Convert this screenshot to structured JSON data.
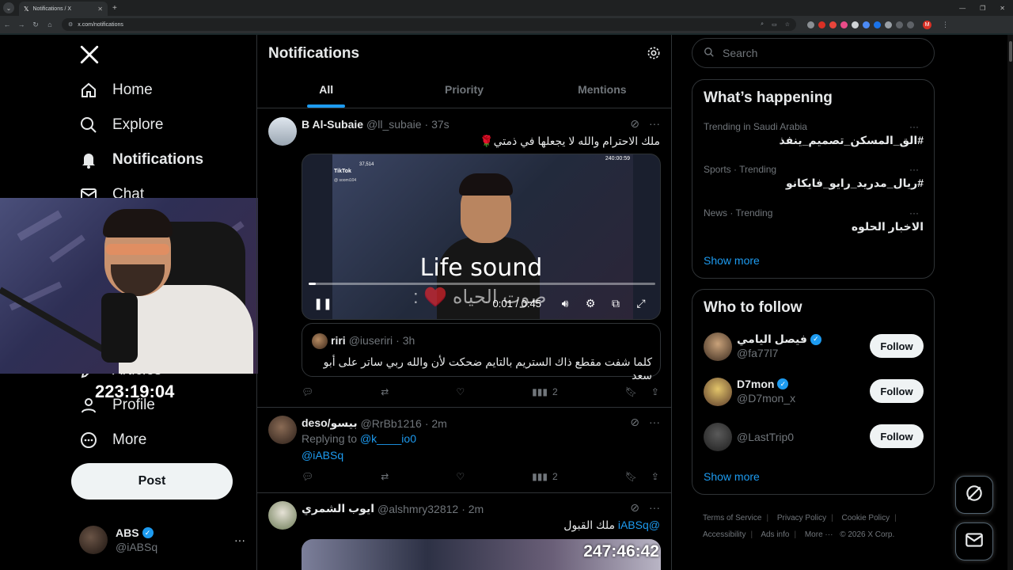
{
  "browser": {
    "tab_title": "Notifications / X",
    "url": "x.com/notifications",
    "profile_initial": "M"
  },
  "nav": {
    "items": [
      {
        "label": "Home",
        "icon": "home-icon"
      },
      {
        "label": "Explore",
        "icon": "search-icon"
      },
      {
        "label": "Notifications",
        "icon": "bell-icon",
        "active": true
      },
      {
        "label": "Chat",
        "icon": "mail-icon"
      },
      {
        "label": "Articles",
        "icon": "article-icon"
      },
      {
        "label": "Profile",
        "icon": "user-icon"
      },
      {
        "label": "More",
        "icon": "more-circle-icon"
      }
    ],
    "post_button": "Post",
    "account": {
      "name": "ABS",
      "handle": "@iABSq"
    }
  },
  "overlay": {
    "timer": "223:19:04"
  },
  "main": {
    "title": "Notifications",
    "tabs": [
      "All",
      "Priority",
      "Mentions"
    ],
    "posts": [
      {
        "name": "B Al-Subaie",
        "handle": "@ll_subaie",
        "time": "· 37s",
        "text": "ملك الاحترام والله لا يجعلها في ذمتي🌹",
        "video": {
          "tiktok_label": "TikTok",
          "tiktok_handle": "@ soomi104",
          "tiktok_count": "37,514",
          "stamp": "240:00:59",
          "caption_en": "Life sound",
          "caption_ar": "صوت الحياه ♥️ :",
          "time": "0:01 / 0:45",
          "progress": 0.02
        },
        "quote": {
          "name": "riri",
          "handle": "@iuseriri",
          "time": "· 3h",
          "text": "كلما شفت مقطع ذاك الستريم بالتايم ضحكت لأن والله ربي ساتر على أبو سعد"
        },
        "views": "2"
      },
      {
        "name": "deso/بيسو",
        "handle": "@RrBb1216",
        "time": "· 2m",
        "replying_to_label": "Replying to",
        "replying_to": "@k____io0",
        "mention": "@iABSq",
        "views": "2"
      },
      {
        "name": "ايوب الشمري",
        "handle": "@alshmry32812",
        "time": "· 2m",
        "text_prefix": "ملك القبول",
        "mention": "@iABSq",
        "video_stamp": "247:46:42"
      }
    ]
  },
  "sidebar": {
    "search_placeholder": "Search",
    "happening_title": "What’s happening",
    "trends": [
      {
        "meta": "Trending in Saudi Arabia",
        "name": "#الق_المسكن_تصميم_ينفذ"
      },
      {
        "meta": "Sports · Trending",
        "name": "#ريال_مدريد_رايو_فايكانو"
      },
      {
        "meta": "News · Trending",
        "name": "الاخبار الحلوه"
      }
    ],
    "show_more": "Show more",
    "who_title": "Who to follow",
    "follow": [
      {
        "name": "فيصل اليامي",
        "handle": "@fa77l7",
        "verified": true
      },
      {
        "name": "D7mon",
        "handle": "@D7mon_x",
        "verified": true
      },
      {
        "name": "",
        "handle": "@LastTrip0",
        "verified": false
      }
    ],
    "follow_label": "Follow",
    "footer": [
      "Terms of Service",
      "Privacy Policy",
      "Cookie Policy",
      "Accessibility",
      "Ads info",
      "More ···",
      "© 2026 X Corp."
    ]
  },
  "colors": {
    "accent": "#1d9bf0",
    "bg": "#000000",
    "border": "#2f3336",
    "muted": "#71767b"
  }
}
